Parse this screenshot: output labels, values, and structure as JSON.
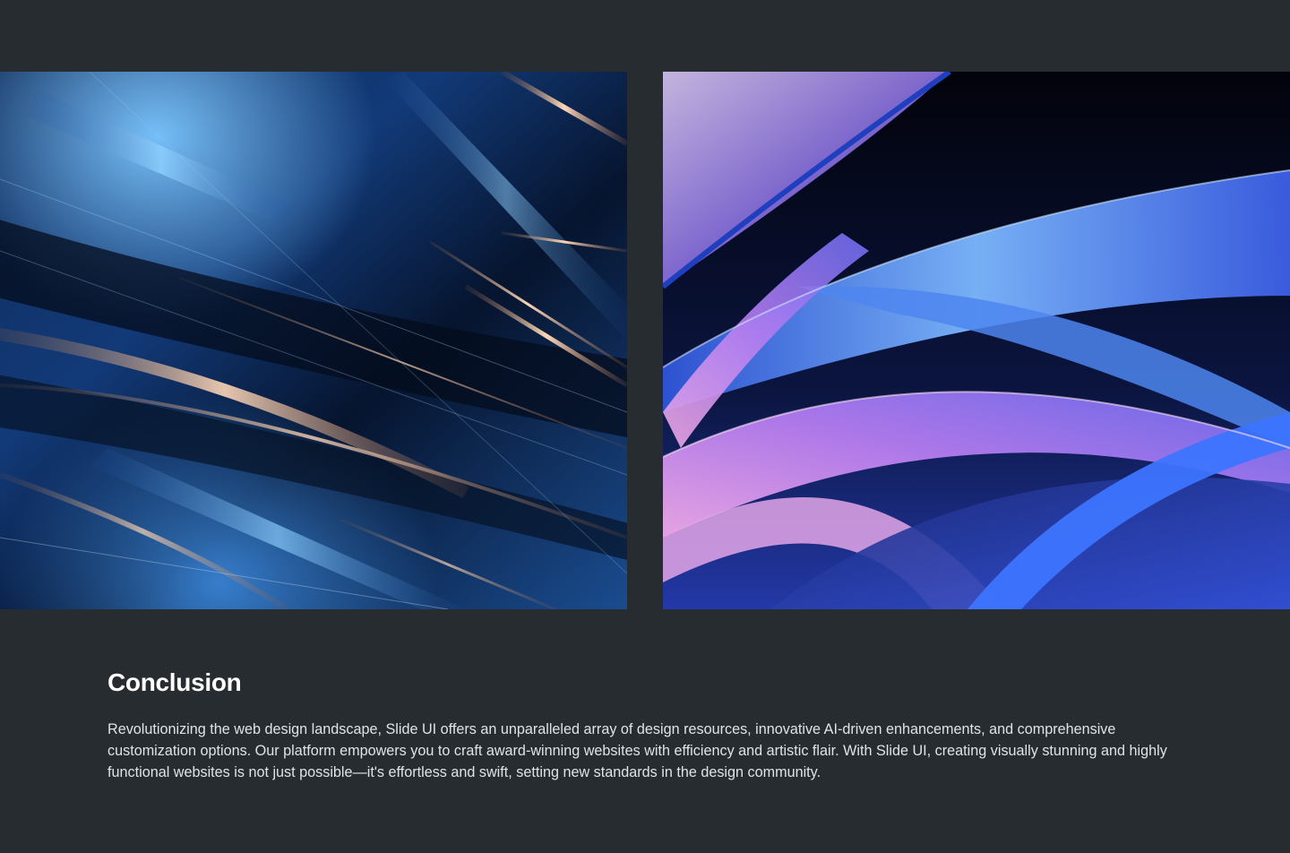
{
  "gallery": {
    "images": [
      {
        "name": "abstract-metallic-streaks-image"
      },
      {
        "name": "abstract-ribbon-waves-image"
      }
    ]
  },
  "conclusion": {
    "heading": "Conclusion",
    "body": "Revolutionizing the web design landscape, Slide UI offers an unparalleled array of design resources, innovative AI-driven enhancements, and comprehensive customization options. Our platform empowers you to craft award-winning websites with efficiency and artistic flair. With Slide UI, creating visually stunning and highly functional websites is not just possible—it's effortless and swift, setting new standards in the design community."
  },
  "colors": {
    "page_background": "#262c30",
    "heading_text": "#ffffff",
    "body_text": "#dfe3e6"
  }
}
